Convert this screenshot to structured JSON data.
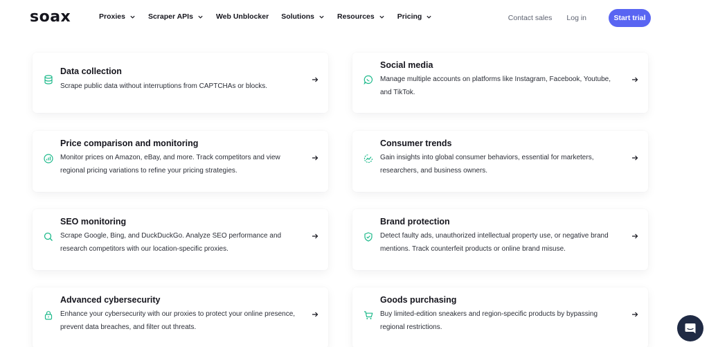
{
  "brand": {
    "logo_text": "soax"
  },
  "nav": {
    "items": [
      {
        "label": "Proxies",
        "has_dropdown": true
      },
      {
        "label": "Scraper APIs",
        "has_dropdown": true
      },
      {
        "label": "Web Unblocker",
        "has_dropdown": false
      },
      {
        "label": "Solutions",
        "has_dropdown": true
      },
      {
        "label": "Resources",
        "has_dropdown": true
      },
      {
        "label": "Pricing",
        "has_dropdown": true
      }
    ],
    "contact_sales": "Contact sales",
    "login": "Log in",
    "cta": "Start trial"
  },
  "colors": {
    "accent": "#5965f2",
    "icon_green": "#1cb98a",
    "text": "#15151d",
    "chat_bg": "#1f2a44"
  },
  "cards": [
    {
      "icon": "database-icon",
      "title": "Data collection",
      "description": "Scrape public data without interruptions from CAPTCHAs or blocks."
    },
    {
      "icon": "chat-bubble-icon",
      "title": "Social media",
      "description": "Manage multiple accounts on platforms like Instagram, Facebook, Youtube, and TikTok."
    },
    {
      "icon": "bar-chart-icon",
      "title": "Price comparison and monitoring",
      "description": "Monitor prices on Amazon, eBay, and more. Track competitors and view regional pricing variations to refine your pricing strategies."
    },
    {
      "icon": "pie-trend-icon",
      "title": "Consumer trends",
      "description": "Gain insights into global consumer behaviors, essential for marketers, researchers, and business owners."
    },
    {
      "icon": "search-icon",
      "title": "SEO monitoring",
      "description": "Scrape Google, Bing, and DuckDuckGo. Analyze SEO performance and research competitors with our location-specific proxies."
    },
    {
      "icon": "shield-check-icon",
      "title": "Brand protection",
      "description": "Detect faulty ads, unauthorized intellectual property use, or negative brand mentions. Track counterfeit products or online brand misuse."
    },
    {
      "icon": "lock-icon",
      "title": "Advanced cybersecurity",
      "description": "Enhance your cybersecurity with our proxies to protect your online presence, prevent data breaches, and filter out threats."
    },
    {
      "icon": "cart-icon",
      "title": "Goods purchasing",
      "description": "Buy limited-edition sneakers and region-specific products by bypassing regional restrictions."
    }
  ],
  "chat": {
    "icon": "chat-widget-icon"
  }
}
